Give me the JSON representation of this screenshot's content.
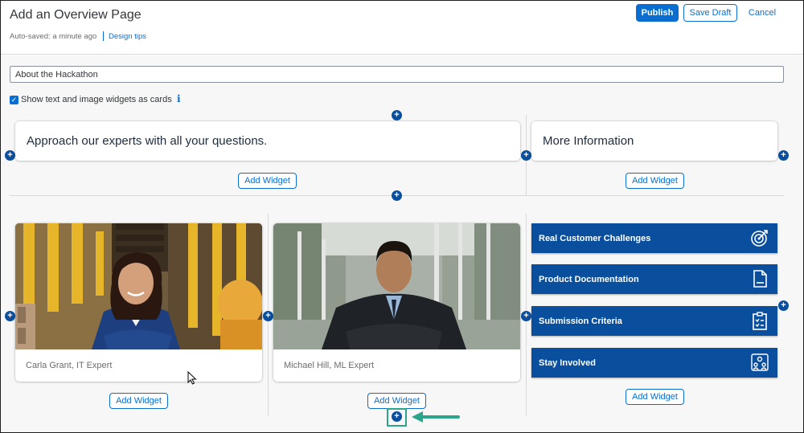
{
  "header": {
    "title": "Add an Overview Page",
    "autosave": "Auto-saved: a minute ago",
    "design_tips": "Design tips",
    "publish": "Publish",
    "save_draft": "Save Draft",
    "cancel": "Cancel"
  },
  "form": {
    "title_value": "About the Hackathon",
    "show_widgets_label": "Show text and image widgets as cards",
    "show_widgets_checked": true
  },
  "widgets": {
    "text_card_1": "Approach our experts with all your questions.",
    "text_card_2": "More Information",
    "add_widget": "Add Widget",
    "image_card_1_caption": "Carla Grant, IT Expert",
    "image_card_2_caption": "Michael Hill, ML Expert",
    "tiles": [
      {
        "label": "Real Customer Challenges",
        "icon": "target-icon"
      },
      {
        "label": "Product Documentation",
        "icon": "document-icon"
      },
      {
        "label": "Submission Criteria",
        "icon": "clipboard-checklist-icon"
      },
      {
        "label": "Stay Involved",
        "icon": "people-group-icon"
      }
    ]
  },
  "colors": {
    "accent": "#0a6ed1",
    "tile_bg": "#0a4f9e",
    "highlight": "#2aa58a"
  }
}
